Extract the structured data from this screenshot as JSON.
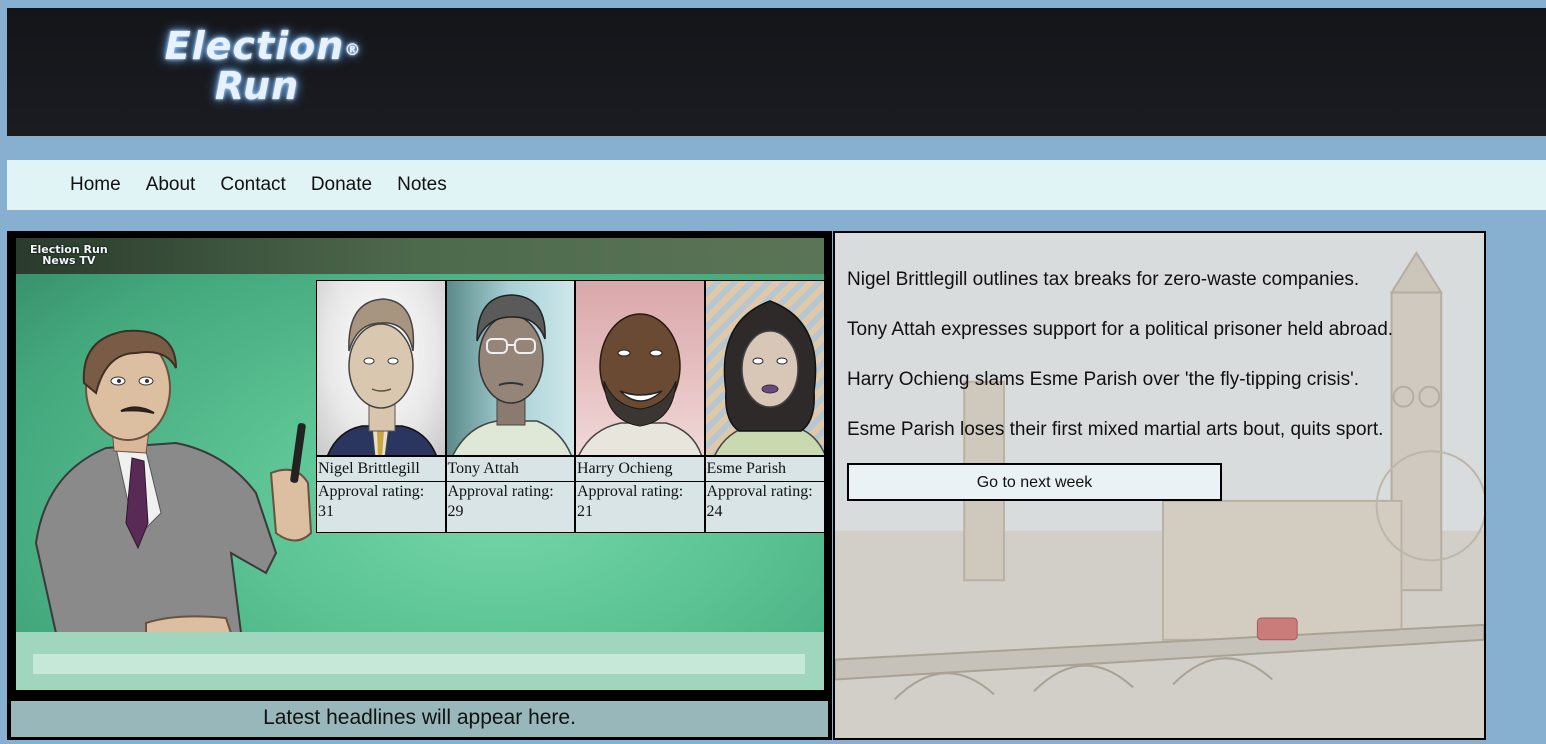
{
  "header": {
    "logo_line1": "Election",
    "logo_reg": "®",
    "logo_line2": "Run"
  },
  "nav": {
    "items": [
      {
        "label": "Home"
      },
      {
        "label": "About"
      },
      {
        "label": "Contact"
      },
      {
        "label": "Donate"
      },
      {
        "label": "Notes"
      }
    ]
  },
  "tv": {
    "logo_line1": "Election Run",
    "logo_line2": "News TV",
    "headline_placeholder": "Latest headlines will appear here."
  },
  "candidates": [
    {
      "name": "Nigel Brittlegill",
      "rating_label": "Approval rating:",
      "rating": 31
    },
    {
      "name": "Tony Attah",
      "rating_label": "Approval rating:",
      "rating": 29
    },
    {
      "name": "Harry Ochieng",
      "rating_label": "Approval rating:",
      "rating": 21
    },
    {
      "name": "Esme Parish",
      "rating_label": "Approval rating:",
      "rating": 24
    }
  ],
  "news": {
    "items": [
      "Nigel Brittlegill outlines tax breaks for zero-waste companies.",
      "Tony Attah expresses support for a political prisoner held abroad.",
      "Harry Ochieng slams Esme Parish over 'the fly-tipping crisis'.",
      "Esme Parish loses their first mixed martial arts bout, quits sport."
    ],
    "next_button": "Go to next week"
  },
  "colors": {
    "page_bg": "#87afcf",
    "header_bg": "#141519",
    "nav_bg": "#e0f4f6",
    "card_bg": "#d8e4e6",
    "headline_bar_bg": "#97b7ba"
  }
}
